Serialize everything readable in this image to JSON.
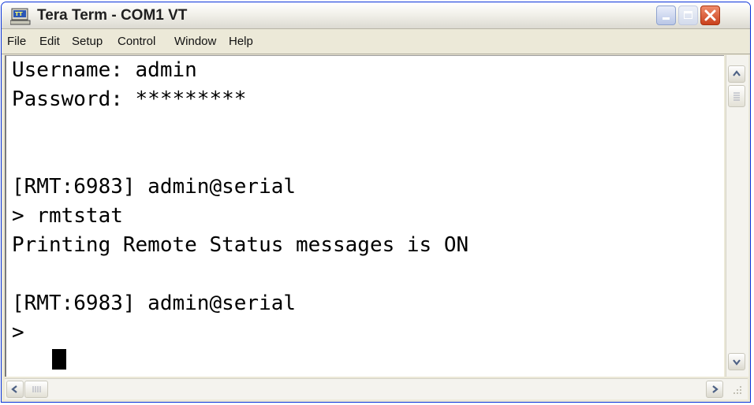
{
  "window": {
    "title": "Tera Term - COM1 VT",
    "app_icon": "teraterm-app-icon",
    "title_bar_color": "#f2f1ea",
    "close_color": "#c9401c"
  },
  "menu": {
    "items": [
      "File",
      "Edit",
      "Setup",
      "Control",
      "Window",
      "Help"
    ]
  },
  "terminal": {
    "lines": [
      "Username: admin",
      "Password: *********",
      "",
      "",
      "[RMT:6983] admin@serial",
      "> rmtstat",
      "Printing Remote Status messages is ON",
      "",
      "[RMT:6983] admin@serial",
      "> "
    ],
    "cursor": "block-cursor",
    "background": "#ffffff",
    "foreground": "#000000"
  },
  "scrollbars": {
    "vertical_icons": [
      "scroll-up-arrow-icon",
      "scroll-thumb-grip-icon",
      "scroll-down-arrow-icon"
    ],
    "horizontal_icons": [
      "scroll-left-arrow-icon",
      "scroll-thumb-grip-icon",
      "scroll-right-arrow-icon",
      "resize-grip-icon"
    ]
  }
}
